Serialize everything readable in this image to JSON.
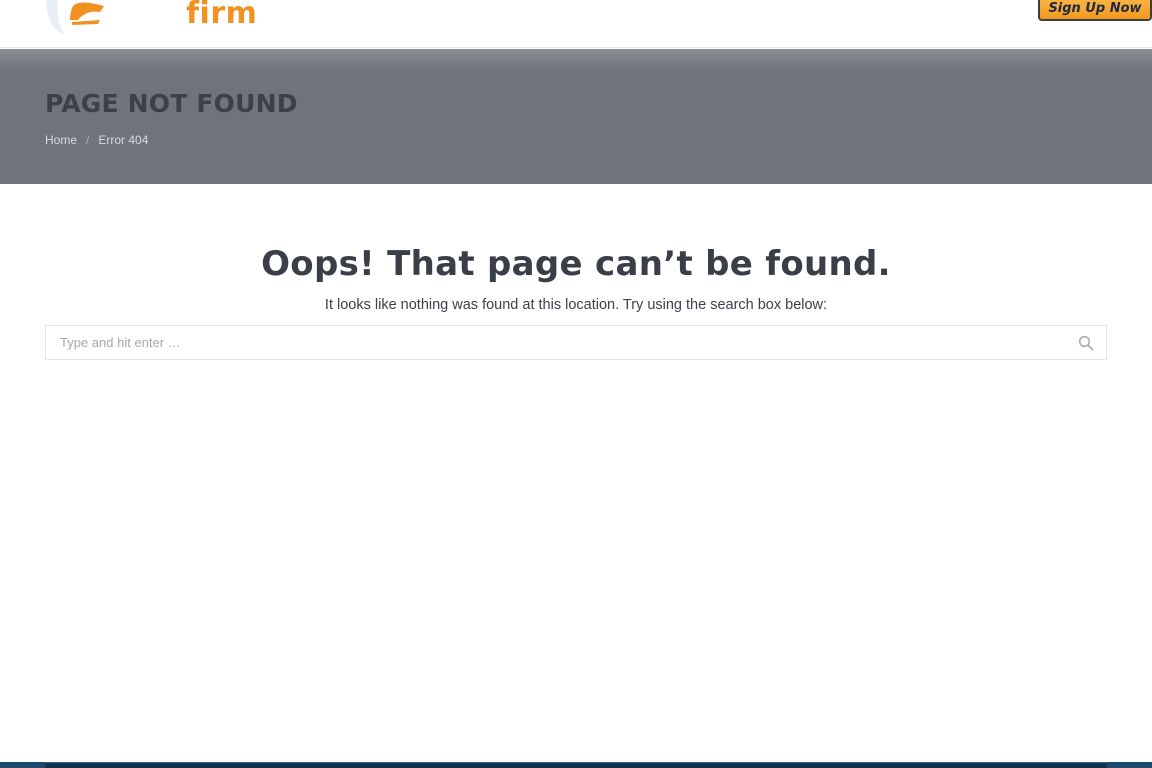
{
  "header": {
    "logo_text": "firm",
    "signup_label": "Sign Up Now"
  },
  "banner": {
    "title": "PAGE NOT FOUND",
    "breadcrumb": {
      "home": "Home",
      "separator": "/",
      "current": "Error 404"
    }
  },
  "main": {
    "heading": "Oops! That page can’t be found.",
    "subtext": "It looks like nothing was found at this location. Try using the search box below:",
    "search": {
      "placeholder": "Type and hit enter …",
      "value": ""
    }
  },
  "icons": {
    "search": "search-icon",
    "logo_mark": "logo-swoosh-icon"
  },
  "colors": {
    "brand_orange": "#f0921f",
    "banner_bg": "#6f747c",
    "title_text": "#3b4049",
    "footer": "#1e4a6b"
  }
}
